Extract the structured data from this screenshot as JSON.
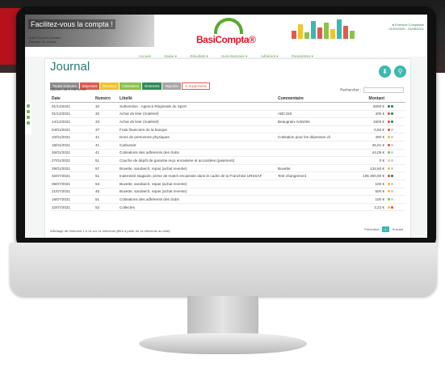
{
  "header": {
    "banner_title": "Facilitez-vous la compta !",
    "user_line1": "Justin Dupont-Lemaire",
    "user_line2": "Changer de compte",
    "logo_text": "BasiCompta®",
    "exercice_line1": "● Exercice Comptable",
    "exercice_line2": "01/09/2020 - 31/08/2021"
  },
  "nav": [
    "Accueil",
    "Saisie ▾",
    "Résultats ▾",
    "Suivi Bancaire ▾",
    "Adhérent ▾",
    "Paramètres ▾"
  ],
  "page": {
    "title": "Journal"
  },
  "tabs": [
    {
      "label": "Toutes écritures",
      "color": "#8e8e8e"
    },
    {
      "label": "Dépenses",
      "color": "#e05a4f"
    },
    {
      "label": "Recettes",
      "color": "#f2c230"
    },
    {
      "label": "Cotisations",
      "color": "#8bc34a"
    },
    {
      "label": "Virements",
      "color": "#2e8b57"
    },
    {
      "label": "Importés",
      "color": "#a6a6a6"
    },
    {
      "label": "⊖ Supprimées",
      "color": "#ffffff"
    }
  ],
  "controls": {
    "afficher": "Afficher  25  ▾  éléments",
    "recherche": "Rechercher :"
  },
  "table": {
    "headers": [
      "Date",
      "Numéro",
      "Libellé",
      "Commentaire",
      "Montant"
    ],
    "rows": [
      {
        "date": "01/12/2021",
        "num": "32",
        "libelle": "Subvention : Agence Régionale du Sport",
        "comment": "",
        "montant": "6000 €",
        "icons": [
          "#2e8b57",
          "#2e8b57"
        ]
      },
      {
        "date": "01/12/2021",
        "num": "32",
        "libelle": "Achat de liser (matériel)",
        "comment": "ABC318",
        "montant": "400 €",
        "icons": [
          "#e05a4f",
          "#2e8b57"
        ]
      },
      {
        "date": "14/12/2021",
        "num": "33",
        "libelle": "Achat de liser (matériel)",
        "comment": "Beaugrain-Activités",
        "montant": "1600 €",
        "icons": [
          "#e05a4f",
          "#2e8b57"
        ]
      },
      {
        "date": "04/01/2021",
        "num": "37",
        "libelle": "Frais financiers de la banque",
        "comment": "",
        "montant": "0,50 €",
        "icons": [
          "#e05a4f",
          "#cfcfcf"
        ]
      },
      {
        "date": "10/01/2021",
        "num": "41",
        "libelle": "Dons de personnes physiques",
        "comment": "Cotisation pour les dépenses vil",
        "montant": "400 €",
        "icons": [
          "#f2c230",
          "#cfcfcf"
        ]
      },
      {
        "date": "18/01/2021",
        "num": "41",
        "libelle": "Carburant",
        "comment": "",
        "montant": "45,01 €",
        "icons": [
          "#e05a4f",
          "#cfcfcf"
        ]
      },
      {
        "date": "26/01/2021",
        "num": "41",
        "libelle": "Cotisations des adhérents des clubs",
        "comment": "",
        "montant": "44,05 €",
        "icons": [
          "#8bc34a",
          "#cfcfcf"
        ]
      },
      {
        "date": "27/01/2021",
        "num": "51",
        "libelle": "Couche de dépôt de garantie reçu encaissée et accordées (paiement)",
        "comment": "",
        "montant": "0 €",
        "icons": [
          "#cfcfcf",
          "#cfcfcf"
        ]
      },
      {
        "date": "29/01/2021",
        "num": "57",
        "libelle": "Buvette, sandwich, repas (achat revente)",
        "comment": "Buvette",
        "montant": "134,50 €",
        "icons": [
          "#f2c230",
          "#cfcfcf"
        ]
      },
      {
        "date": "02/07/2021",
        "num": "51",
        "libelle": "Indemnité stagiaire, prime de match encaissée dans le cadre de la Franchise URSSAF",
        "comment": "Test changement",
        "montant": "105 300,00 €",
        "icons": [
          "#e05a4f",
          "#2e8b57"
        ]
      },
      {
        "date": "08/07/2021",
        "num": "53",
        "libelle": "Buvette, sandwich, repas (achat revente)",
        "comment": "",
        "montant": "100 €",
        "icons": [
          "#f2c230",
          "#cfcfcf"
        ]
      },
      {
        "date": "21/07/2021",
        "num": "45",
        "libelle": "Buvette, sandwich, repas (achat revente)",
        "comment": "",
        "montant": "500 €",
        "icons": [
          "#f2c230",
          "#cfcfcf"
        ]
      },
      {
        "date": "18/07/2021",
        "num": "51",
        "libelle": "Cotisations des adhérents des clubs",
        "comment": "",
        "montant": "100 €",
        "icons": [
          "#8bc34a",
          "#cfcfcf"
        ]
      },
      {
        "date": "22/07/2021",
        "num": "52",
        "libelle": "Collectes",
        "comment": "",
        "montant": "3,22 €",
        "icons": [
          "#f2c230",
          "#e05a4f"
        ]
      }
    ]
  },
  "footer": {
    "info": "Affichage de l'élément 1 à 14 sur 14 éléments (filtré à partir de 14 éléments au total)",
    "prev": "Précédent",
    "page": "1",
    "next": "Suivant"
  }
}
